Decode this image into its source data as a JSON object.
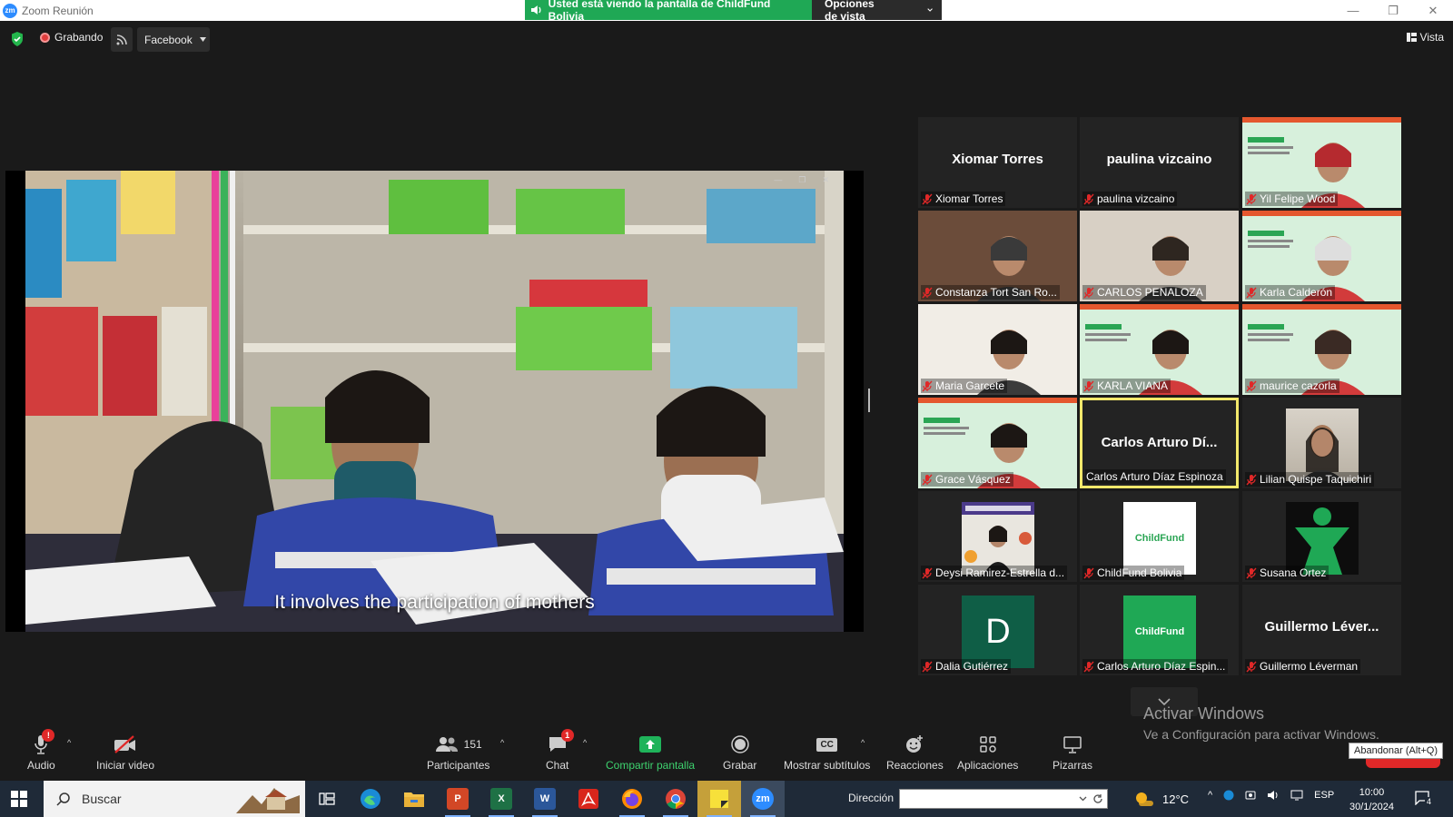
{
  "window": {
    "app_logo": "zm",
    "title": "Zoom Reunión",
    "minimize": "—",
    "restore": "❐",
    "close": "✕"
  },
  "share_banner": {
    "message": "Usted está viendo la pantalla de ChildFund Bolivia",
    "options_label": "Opciones de vista",
    "color": "#1fa855"
  },
  "topbar": {
    "recording_label": "Grabando",
    "stream_target": "Facebook",
    "view_label": "Vista"
  },
  "shared_screen": {
    "subtitle": "It involves the participation of mothers"
  },
  "gallery": {
    "tiles": [
      {
        "label": "Xiomar Torres",
        "display_name": "Xiomar Torres",
        "video": false
      },
      {
        "label": "paulina vizcaino",
        "display_name": "paulina vizcaino",
        "video": false
      },
      {
        "label": "Yil Felipe Wood",
        "video": true
      },
      {
        "label": "Constanza Tort San Ro...",
        "video": true
      },
      {
        "label": "CARLOS PENALOZA",
        "video": true
      },
      {
        "label": "Karla Calderón",
        "video": true
      },
      {
        "label": "Maria Garcete",
        "video": true
      },
      {
        "label": "KARLA VIANA",
        "video": true
      },
      {
        "label": "maurice cazorla",
        "video": true
      },
      {
        "label": "Grace Vásquez",
        "video": true
      },
      {
        "label": "Carlos Arturo Díaz Espinoza",
        "display_name": "Carlos Arturo Dí...",
        "video": false,
        "active_speaker": true
      },
      {
        "label": "Lilian Quispe Taquichiri",
        "video": false,
        "avatar": "photo"
      },
      {
        "label": "Deysi Ramirez-Estrella d...",
        "video": false,
        "avatar": "poster"
      },
      {
        "label": "ChildFund Bolivia",
        "video": false,
        "avatar": "logo",
        "avatar_text": "ChildFund"
      },
      {
        "label": "Susana Ortez",
        "video": false,
        "avatar": "green"
      },
      {
        "label": "Dalia Gutiérrez",
        "video": false,
        "avatar": "letter",
        "avatar_text": "D"
      },
      {
        "label": "Carlos Arturo Díaz Espin...",
        "video": false,
        "avatar": "logo50",
        "avatar_text": "ChildFund"
      },
      {
        "label": "Guillermo Léverman",
        "display_name": "Guillermo Léver...",
        "video": false
      }
    ]
  },
  "activation": {
    "title": "Activar Windows",
    "subtitle": "Ve a Configuración para activar Windows.",
    "leave_tooltip": "Abandonar (Alt+Q)"
  },
  "meeting_toolbar": {
    "audio": "Audio",
    "audio_badge": "!",
    "video": "Iniciar video",
    "participants": "Participantes",
    "participants_count": "151",
    "chat": "Chat",
    "chat_badge": "1",
    "share": "Compartir pantalla",
    "record": "Grabar",
    "captions": "Mostrar subtítulos",
    "captions_icon_text": "CC",
    "reactions": "Reacciones",
    "apps": "Aplicaciones",
    "whiteboards": "Pizarras"
  },
  "taskbar": {
    "search_placeholder": "Buscar",
    "apps": [
      "task-view",
      "edge",
      "file-explorer",
      "powerpoint",
      "excel",
      "word",
      "acrobat",
      "firefox",
      "chrome",
      "sticky-notes",
      "zoom"
    ],
    "app_letters": {
      "powerpoint": "P",
      "excel": "X",
      "word": "W",
      "zoom": "zm"
    },
    "address_label": "Dirección",
    "temperature": "12°C",
    "language": "ESP",
    "time": "10:00",
    "date": "30/1/2024",
    "notification_count": "4"
  }
}
